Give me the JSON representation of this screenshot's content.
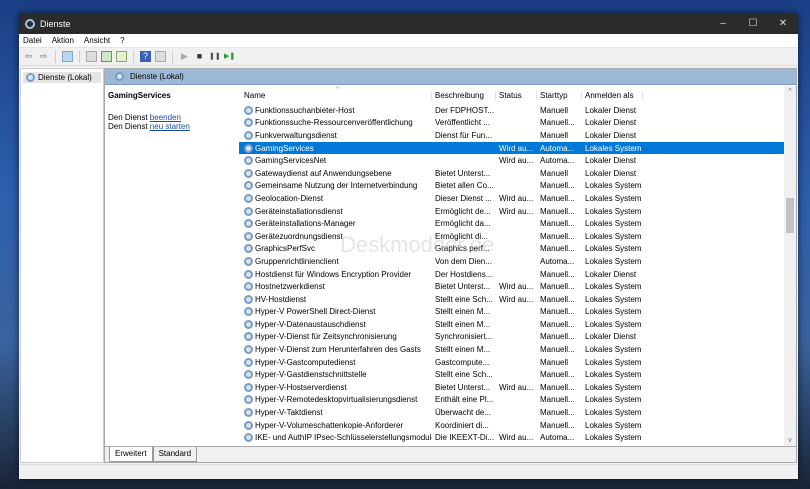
{
  "window": {
    "title": "Dienste",
    "minimize": "–",
    "maximize": "☐",
    "close": "✕"
  },
  "menu": [
    "Datei",
    "Aktion",
    "Ansicht",
    "?"
  ],
  "toolbar": {
    "back": "⇦",
    "forward": "⇨",
    "play": "▶",
    "stop": "■",
    "pause": "❚❚",
    "restart": "▶❚"
  },
  "tree": {
    "node": "Dienste (Lokal)"
  },
  "pane": {
    "header": "Dienste (Lokal)",
    "selected_service": "GamingServices",
    "line1_prefix": "Den Dienst ",
    "line1_link": "beenden",
    "line2_prefix": "Den Dienst ",
    "line2_link": "neu starten"
  },
  "columns": [
    "Name",
    "Beschreibung",
    "Status",
    "Starttyp",
    "Anmelden als"
  ],
  "rows": [
    [
      "Funktionssuchanbieter-Host",
      "Der FDPHOST...",
      "",
      "Manuell",
      "Lokaler Dienst"
    ],
    [
      "Funktionssuche-Ressourcenveröffentlichung",
      "Veröffentlicht ...",
      "",
      "Manuell...",
      "Lokaler Dienst"
    ],
    [
      "Funkverwaltungsdienst",
      "Dienst für Fun...",
      "",
      "Manuell",
      "Lokaler Dienst"
    ],
    [
      "GamingServices",
      "",
      "Wird au...",
      "Automa...",
      "Lokales System"
    ],
    [
      "GamingServicesNet",
      "",
      "Wird au...",
      "Automa...",
      "Lokaler Dienst"
    ],
    [
      "Gatewaydienst auf Anwendungsebene",
      "Bietet Unterst...",
      "",
      "Manuell",
      "Lokaler Dienst"
    ],
    [
      "Gemeinsame Nutzung der Internetverbindung",
      "Bietet allen Co...",
      "",
      "Manuell...",
      "Lokales System"
    ],
    [
      "Geolocation-Dienst",
      "Dieser Dienst ...",
      "Wird au...",
      "Manuell...",
      "Lokales System"
    ],
    [
      "Geräteinstallationsdienst",
      "Ermöglicht de...",
      "Wird au...",
      "Manuell...",
      "Lokales System"
    ],
    [
      "Geräteinstallations-Manager",
      "Ermöglicht da...",
      "",
      "Manuell...",
      "Lokales System"
    ],
    [
      "Gerätezuordnungsdienst",
      "Ermöglicht di...",
      "",
      "Manuell...",
      "Lokales System"
    ],
    [
      "GraphicsPerfSvc",
      "Graphics perf...",
      "",
      "Manuell...",
      "Lokales System"
    ],
    [
      "Gruppenrichtlinienclient",
      "Von dem Dien...",
      "",
      "Automa...",
      "Lokales System"
    ],
    [
      "Hostdienst für Windows Encryption Provider",
      "Der Hostdiens...",
      "",
      "Manuell...",
      "Lokaler Dienst"
    ],
    [
      "Hostnetzwerkdienst",
      "Bietet Unterst...",
      "Wird au...",
      "Manuell...",
      "Lokales System"
    ],
    [
      "HV-Hostdienst",
      "Stellt eine Sch...",
      "Wird au...",
      "Manuell...",
      "Lokales System"
    ],
    [
      "Hyper-V PowerShell Direct-Dienst",
      "Stellt einen M...",
      "",
      "Manuell...",
      "Lokales System"
    ],
    [
      "Hyper-V-Datenaustauschdienst",
      "Stellt einen M...",
      "",
      "Manuell...",
      "Lokales System"
    ],
    [
      "Hyper-V-Dienst für Zeitsynchronisierung",
      "Synchronisiert...",
      "",
      "Manuell...",
      "Lokaler Dienst"
    ],
    [
      "Hyper-V-Dienst zum Herunterfahren des Gasts",
      "Stellt einen M...",
      "",
      "Manuell...",
      "Lokales System"
    ],
    [
      "Hyper-V-Gastcomputedienst",
      "Gastcompute...",
      "",
      "Manuell",
      "Lokales System"
    ],
    [
      "Hyper-V-Gastdienstschnittstelle",
      "Stellt eine Sch...",
      "",
      "Manuell...",
      "Lokales System"
    ],
    [
      "Hyper-V-Hostserverdienst",
      "Bietet Unterst...",
      "Wird au...",
      "Manuell...",
      "Lokales System"
    ],
    [
      "Hyper-V-Remotedesktopvirtualisierungsdienst",
      "Enthält eine Pl...",
      "",
      "Manuell...",
      "Lokales System"
    ],
    [
      "Hyper-V-Taktdienst",
      "Überwacht de...",
      "",
      "Manuell...",
      "Lokales System"
    ],
    [
      "Hyper-V-Volumeschattenkopie-Anforderer",
      "Koordiniert di...",
      "",
      "Manuell...",
      "Lokales System"
    ],
    [
      "IKE- und AuthIP IPsec-Schlüsselerstellungsmodule",
      "Die IKEEXT-Di...",
      "Wird au...",
      "Automa...",
      "Lokales System"
    ]
  ],
  "selected_index": 3,
  "tabs": [
    "Erweitert",
    "Standard"
  ],
  "watermark": "Deskmodder.de"
}
